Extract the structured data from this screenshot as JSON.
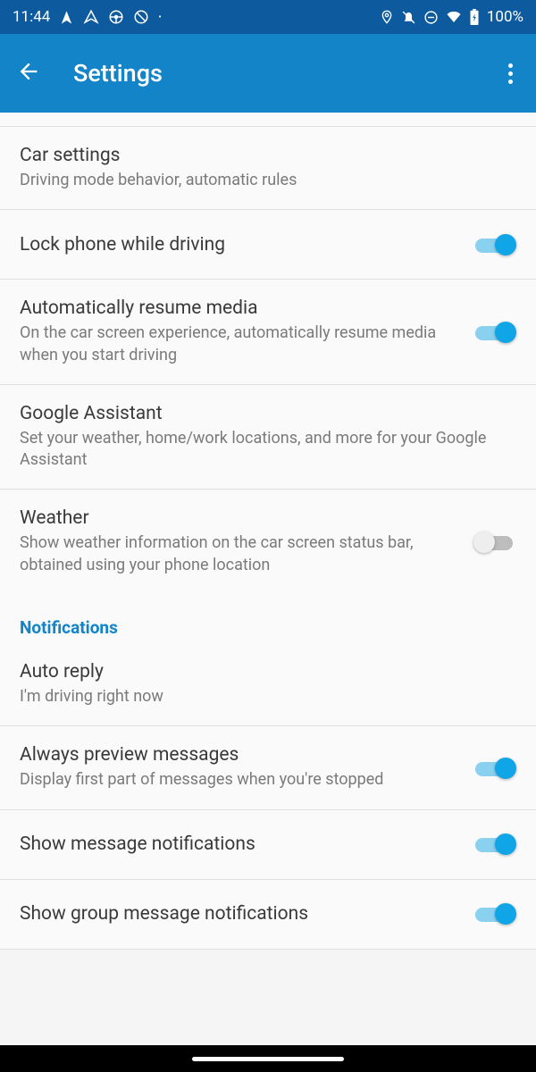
{
  "status": {
    "time": "11:44",
    "battery": "100%"
  },
  "header": {
    "title": "Settings"
  },
  "rows": {
    "car": {
      "title": "Car settings",
      "sub": "Driving mode behavior, automatic rules"
    },
    "lock": {
      "title": "Lock phone while driving",
      "on": true
    },
    "resume": {
      "title": "Automatically resume media",
      "sub": "On the car screen experience, automatically resume media when you start driving",
      "on": true
    },
    "assistant": {
      "title": "Google Assistant",
      "sub": "Set your weather, home/work locations, and more for your Google Assistant"
    },
    "weather": {
      "title": "Weather",
      "sub": "Show weather information on the car screen status bar, obtained using your phone location",
      "on": false
    },
    "autoreply": {
      "title": "Auto reply",
      "sub": "I'm driving right now"
    },
    "preview": {
      "title": "Always preview messages",
      "sub": "Display first part of messages when you're stopped",
      "on": true
    },
    "shownotif": {
      "title": "Show message notifications",
      "on": true
    },
    "showgroup": {
      "title": "Show group message notifications",
      "on": true
    }
  },
  "sections": {
    "notifications": "Notifications"
  }
}
